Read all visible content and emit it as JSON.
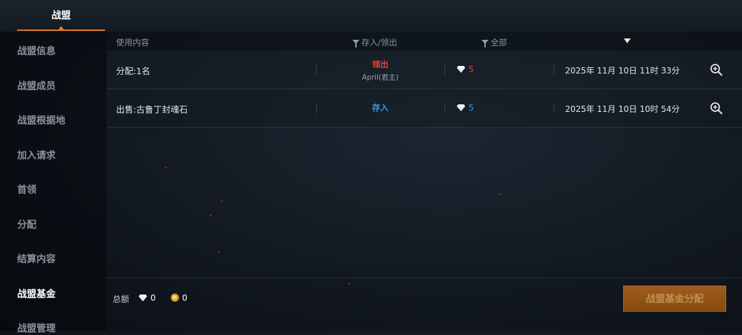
{
  "top_tab": {
    "label": "战盟"
  },
  "sidebar": {
    "items": [
      {
        "label": "战盟信息"
      },
      {
        "label": "战盟成员"
      },
      {
        "label": "战盟根据地"
      },
      {
        "label": "加入请求"
      },
      {
        "label": "首领"
      },
      {
        "label": "分配"
      },
      {
        "label": "结算内容"
      },
      {
        "label": "战盟基金",
        "active": true
      },
      {
        "label": "战盟管理"
      }
    ]
  },
  "table": {
    "headers": {
      "content": "使用内容",
      "type_filter": "存入/领出",
      "currency_filter": "全部"
    },
    "rows": [
      {
        "content": "分配:1名",
        "type": "领出",
        "type_color": "#e0443a",
        "user": "April(君主)",
        "currency_icon": "diamond-icon",
        "amount": "5",
        "amount_color": "#e0443a",
        "time": "2025年 11月 10日 11时 33分"
      },
      {
        "content": "出售:古鲁丁封魂石",
        "type": "存入",
        "type_color": "#3e95e0",
        "user": "",
        "currency_icon": "diamond-icon",
        "amount": "5",
        "amount_color": "#3e95e0",
        "time": "2025年 11月 10日 10时 54分"
      }
    ]
  },
  "footer": {
    "total_label": "总额",
    "diamond_total": "0",
    "gold_total": "0",
    "distribute_button": "战盟基金分配"
  },
  "colors": {
    "accent": "#e07a2a",
    "withdraw": "#e0443a",
    "deposit": "#3e95e0"
  }
}
